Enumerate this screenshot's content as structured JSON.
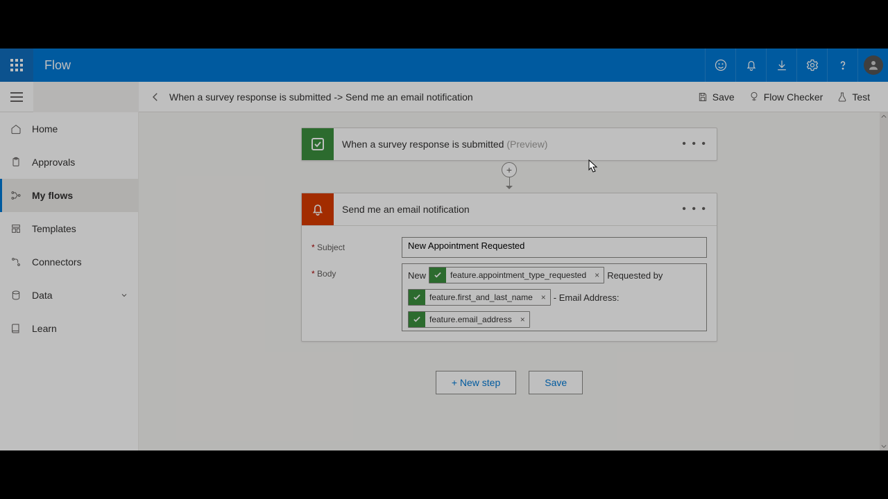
{
  "app": {
    "title": "Flow"
  },
  "commandbar": {
    "breadcrumb": "When a survey response is submitted -> Send me an email notification",
    "save": "Save",
    "checker": "Flow Checker",
    "test": "Test"
  },
  "nav": {
    "items": [
      {
        "label": "Home"
      },
      {
        "label": "Approvals"
      },
      {
        "label": "My flows"
      },
      {
        "label": "Templates"
      },
      {
        "label": "Connectors"
      },
      {
        "label": "Data"
      },
      {
        "label": "Learn"
      }
    ]
  },
  "trigger": {
    "title": "When a survey response is submitted",
    "preview": "(Preview)"
  },
  "action": {
    "title": "Send me an email notification",
    "fields": {
      "subject_label": "Subject",
      "subject_value": "New Appointment Requested",
      "body_label": "Body",
      "body": {
        "t1": "New",
        "tok1": "feature.appointment_type_requested",
        "t2": "Requested by",
        "tok2": "feature.first_and_last_name",
        "t3": "- Email Address:",
        "tok3": "feature.email_address"
      }
    }
  },
  "buttons": {
    "new_step": "+ New step",
    "save": "Save"
  }
}
